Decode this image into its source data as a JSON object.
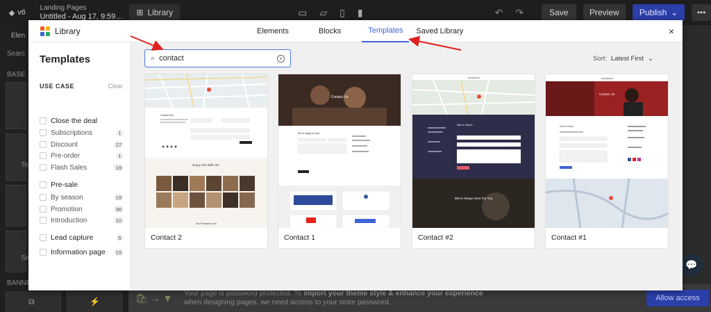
{
  "topbar": {
    "logo_version": "v6",
    "breadcrumb": "Landing Pages",
    "page_title": "Untitled - Aug 17, 9:59…",
    "library_label": "Library",
    "save_label": "Save",
    "preview_label": "Preview",
    "publish_label": "Publish",
    "more_label": "•••"
  },
  "leftdim": {
    "elements_tab": "Elen",
    "search_ph": "Searc",
    "base_label": "BASE",
    "text_label": "Tex",
    "sel_label": "Se",
    "banner_label": "BANNE"
  },
  "notice": {
    "line1_prefix": "Your page is password protected. To ",
    "line1_bold": "import your theme style & enhance your experience",
    "line2": "when designing pages, we need access to your store password.",
    "allow_label": "Allow access"
  },
  "modal": {
    "title": "Library",
    "tabs": [
      {
        "label": "Elements",
        "active": false
      },
      {
        "label": "Blocks",
        "active": false
      },
      {
        "label": "Templates",
        "active": true
      },
      {
        "label": "Saved Library",
        "active": false
      }
    ],
    "close_label": "×"
  },
  "sidebar": {
    "title": "Templates",
    "section_label": "USE CASE",
    "clear_label": "Clear",
    "categories": [
      {
        "label": "Close the deal",
        "count": "",
        "bold": true
      },
      {
        "label": "Subscriptions",
        "count": "1",
        "bold": false
      },
      {
        "label": "Discount",
        "count": "27",
        "bold": false
      },
      {
        "label": "Pre-order",
        "count": "1",
        "bold": false
      },
      {
        "label": "Flash Sales",
        "count": "19",
        "bold": false
      },
      {
        "label": "Pre-sale",
        "count": "",
        "bold": true
      },
      {
        "label": "By season",
        "count": "19",
        "bold": false
      },
      {
        "label": "Promotion",
        "count": "36",
        "bold": false
      },
      {
        "label": "Introduction",
        "count": "10",
        "bold": false
      },
      {
        "label": "Lead capture",
        "count": "5",
        "bold": true
      },
      {
        "label": "Information page",
        "count": "15",
        "bold": true
      }
    ]
  },
  "search": {
    "value": "contact"
  },
  "sort": {
    "label": "Sort:",
    "value": "Latest First"
  },
  "cards": [
    {
      "name": "Contact 2",
      "heading": "Contact Info",
      "tagline": "Enjoy Life With Us !",
      "footer": "Our Promise to You"
    },
    {
      "name": "Contact 1",
      "heading": "Contact Us",
      "form_title": "We're happy to help"
    },
    {
      "name": "Contact #2",
      "brand": "GRANDMAN",
      "form_title": "Get In Touch",
      "banner_text": "We're Always Here For You"
    },
    {
      "name": "Contact #1",
      "brand": "GRANDMAN",
      "heading": "Contact Us",
      "form_title": "Get In Touch"
    }
  ],
  "colors": {
    "accent": "#3f63d6",
    "publish": "#2b3fa8",
    "arrow": "#e02020"
  }
}
